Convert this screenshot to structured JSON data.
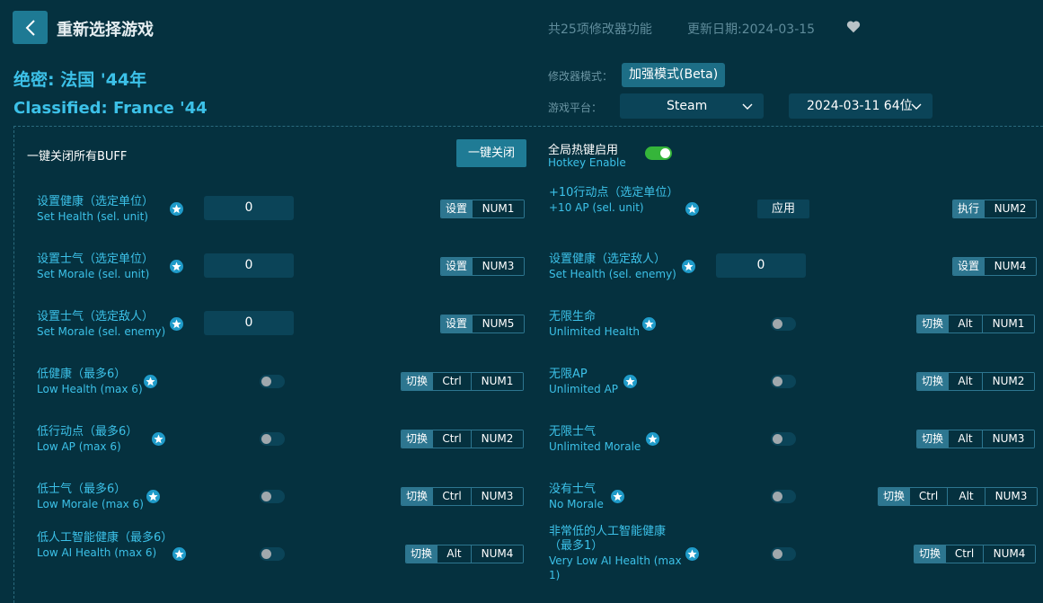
{
  "header": {
    "title": "重新选择游戏",
    "feature_count": "共25项修改器功能",
    "update_date": "更新日期:2024-03-15"
  },
  "game": {
    "name_cn": "绝密: 法国 '44年",
    "name_en": "Classified: France '44"
  },
  "mode": {
    "label": "修改器模式：",
    "value": "加强模式(Beta)"
  },
  "platform": {
    "label": "游戏平台：",
    "value": "Steam",
    "version": "2024-03-11 64位"
  },
  "global": {
    "all_buff_label": "一键关闭所有BUFF",
    "close_all_button": "一键关闭",
    "hotkey_cn": "全局热键启用",
    "hotkey_en": "Hotkey Enable"
  },
  "features": [
    {
      "cn": "设置健康（选定单位）",
      "en": "Set Health (sel. unit)",
      "value": "0",
      "action": "设置",
      "keys": [
        "NUM1"
      ]
    },
    {
      "cn": "+10行动点（选定单位）",
      "en": "+10 AP (sel. unit)",
      "apply": "应用",
      "action": "执行",
      "keys": [
        "NUM2"
      ]
    },
    {
      "cn": "设置士气（选定单位）",
      "en": "Set Morale (sel. unit)",
      "value": "0",
      "action": "设置",
      "keys": [
        "NUM3"
      ]
    },
    {
      "cn": "设置健康（选定敌人）",
      "en": "Set Health (sel. enemy)",
      "value": "0",
      "action": "设置",
      "keys": [
        "NUM4"
      ]
    },
    {
      "cn": "设置士气（选定敌人）",
      "en": "Set Morale (sel. enemy)",
      "value": "0",
      "action": "设置",
      "keys": [
        "NUM5"
      ]
    },
    {
      "cn": "无限生命",
      "en": "Unlimited Health",
      "action": "切换",
      "keys": [
        "Alt",
        "NUM1"
      ]
    },
    {
      "cn": "低健康（最多6）",
      "en": "Low Health (max 6)",
      "action": "切换",
      "keys": [
        "Ctrl",
        "NUM1"
      ]
    },
    {
      "cn": "无限AP",
      "en": "Unlimited AP",
      "action": "切换",
      "keys": [
        "Alt",
        "NUM2"
      ]
    },
    {
      "cn": "低行动点（最多6）",
      "en": "Low AP (max 6)",
      "action": "切换",
      "keys": [
        "Ctrl",
        "NUM2"
      ]
    },
    {
      "cn": "无限士气",
      "en": "Unlimited Morale",
      "action": "切换",
      "keys": [
        "Alt",
        "NUM3"
      ]
    },
    {
      "cn": "低士气（最多6）",
      "en": "Low Morale (max 6)",
      "action": "切换",
      "keys": [
        "Ctrl",
        "NUM3"
      ]
    },
    {
      "cn": "没有士气",
      "en": "No Morale",
      "action": "切换",
      "keys": [
        "Ctrl",
        "Alt",
        "NUM3"
      ]
    },
    {
      "cn": "低人工智能健康（最多6）",
      "en": "Low AI Health (max 6)",
      "action": "切换",
      "keys": [
        "Alt",
        "NUM4"
      ]
    },
    {
      "cn": "非常低的人工智能健康（最多1）",
      "en": "Very Low AI Health (max 1)",
      "action": "切换",
      "keys": [
        "Ctrl",
        "NUM4"
      ]
    }
  ]
}
